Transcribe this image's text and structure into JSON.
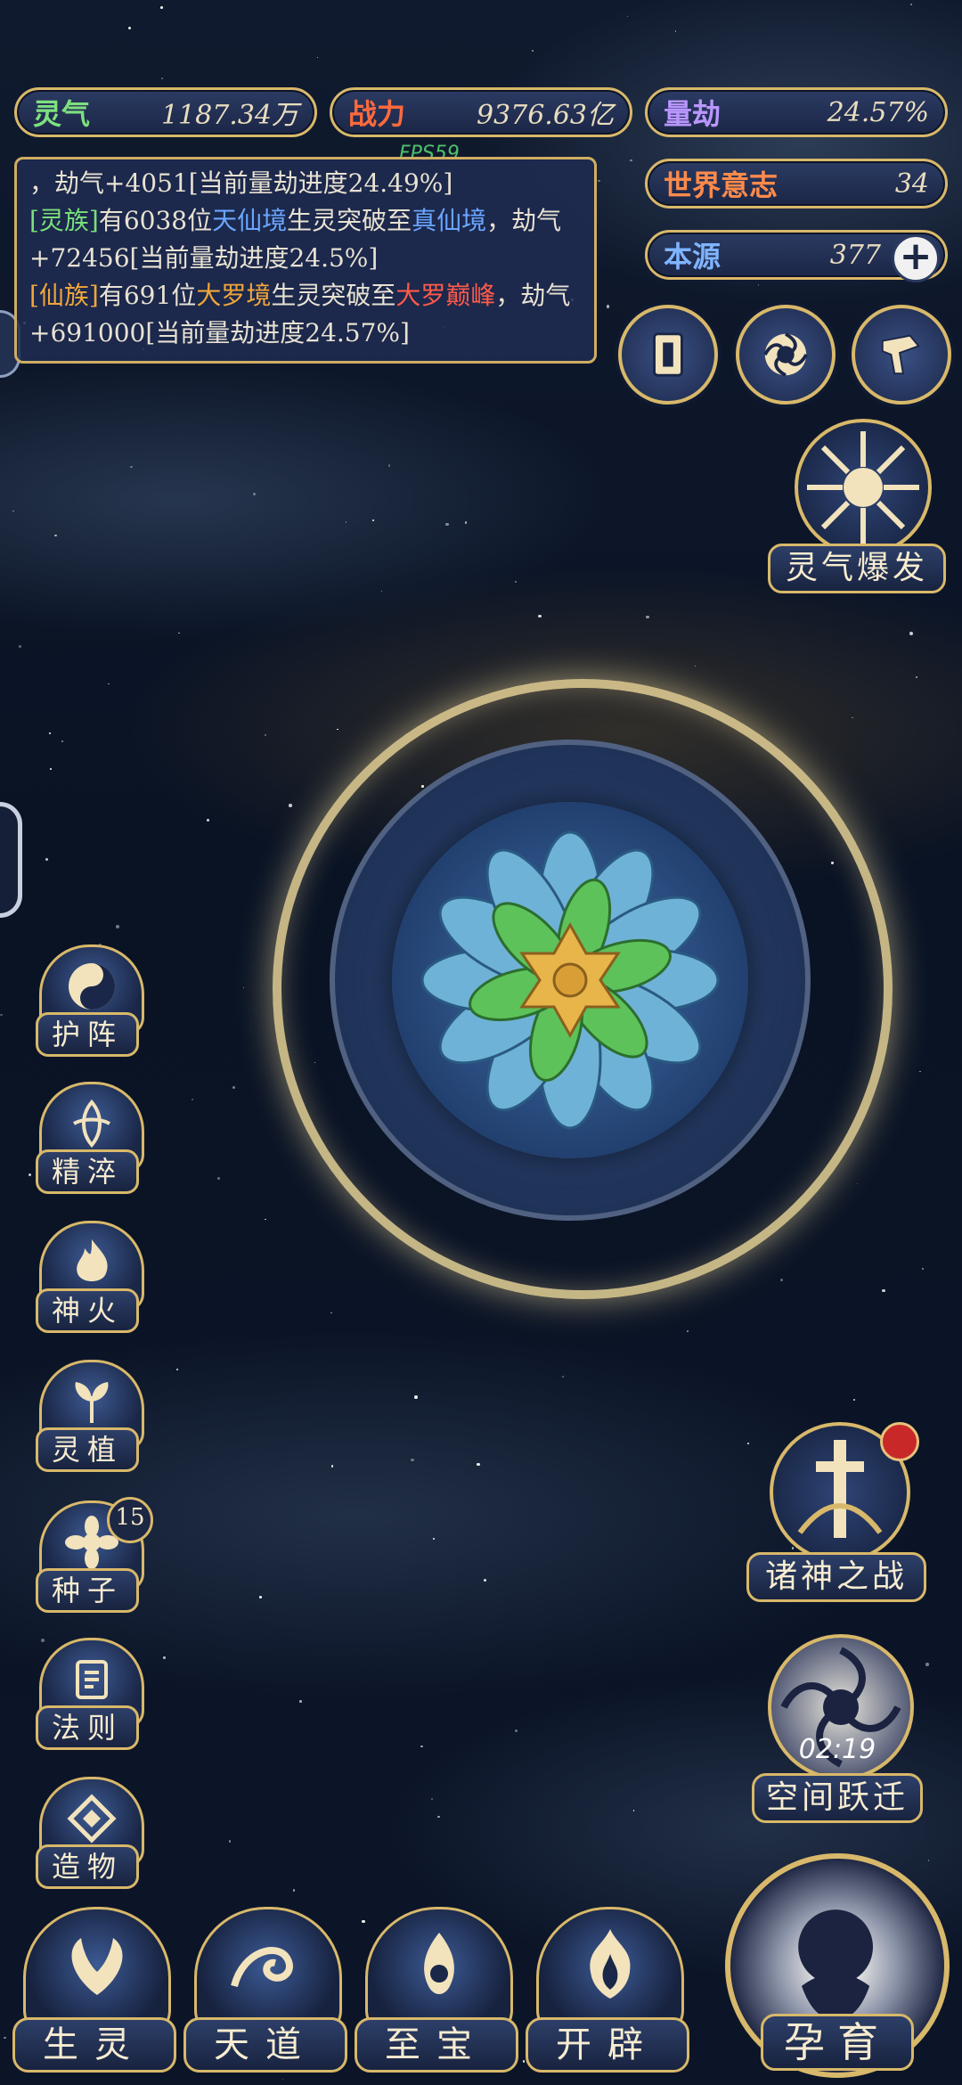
{
  "colors": {
    "gold": "#d8b86a",
    "panel": "#1e2c52",
    "log_blue": "#6aa6ff",
    "log_green": "#79e07a",
    "log_orange": "#f0a63a",
    "log_red": "#ff5a4a"
  },
  "stats": {
    "lingqi": {
      "label": "灵气",
      "value": "1187.34万",
      "label_color": "#7ee07e"
    },
    "zhanli": {
      "label": "战力",
      "value": "9376.63亿",
      "label_color": "#ff6a3d"
    },
    "liangjie": {
      "label": "量劫",
      "value": "24.57%",
      "label_color": "#b996ff"
    },
    "shijie": {
      "label": "世界意志",
      "value": "34",
      "label_color": "#ff8a4a"
    },
    "benyuan": {
      "label": "本源",
      "value": "377",
      "label_color": "#7fb4ff",
      "plus_icon": "plus-icon"
    }
  },
  "fps": "FPS59",
  "log": {
    "line1": "，劫气+4051[当前量劫进度24.49%]",
    "entry2": {
      "race": "[灵族]",
      "t1": "有6038位",
      "realm_from": "天仙境",
      "t2": "生灵突破至",
      "realm_to": "真仙境",
      "t3": "，劫气+72456[当前量劫进度24.5%]"
    },
    "entry3": {
      "race": "[仙族]",
      "t1": "有691位",
      "realm_from": "大罗境",
      "t2": "生灵突破至",
      "realm_to": "大罗巅峰",
      "t3": "，劫气+691000[当前量劫进度24.57%]"
    }
  },
  "top_buttons": [
    {
      "icon": "card-icon"
    },
    {
      "icon": "vortex-icon"
    },
    {
      "icon": "hammer-icon"
    }
  ],
  "burst": {
    "label": "灵气爆发",
    "icon": "burst-icon"
  },
  "side_menu": [
    {
      "label": "护阵",
      "icon": "yin-yang-icon"
    },
    {
      "label": "精淬",
      "icon": "refine-icon"
    },
    {
      "label": "神火",
      "icon": "flame-icon"
    },
    {
      "label": "灵植",
      "icon": "plant-icon"
    },
    {
      "label": "种子",
      "icon": "seed-icon",
      "badge": "15"
    },
    {
      "label": "法则",
      "icon": "law-icon"
    },
    {
      "label": "造物",
      "icon": "create-icon"
    }
  ],
  "battle": {
    "label": "诸神之战",
    "icon": "sword-icon",
    "has_alert": true
  },
  "jump": {
    "label": "空间跃迁",
    "timer": "02:19",
    "icon": "vortex-icon"
  },
  "bottom_tabs": [
    {
      "label": "生灵",
      "icon": "phoenix-icon"
    },
    {
      "label": "天道",
      "icon": "wave-icon"
    },
    {
      "label": "至宝",
      "icon": "treasure-icon"
    },
    {
      "label": "开辟",
      "icon": "axe-flame-icon"
    }
  ],
  "incubate": {
    "label": "孕育",
    "icon": "embryo-icon"
  }
}
